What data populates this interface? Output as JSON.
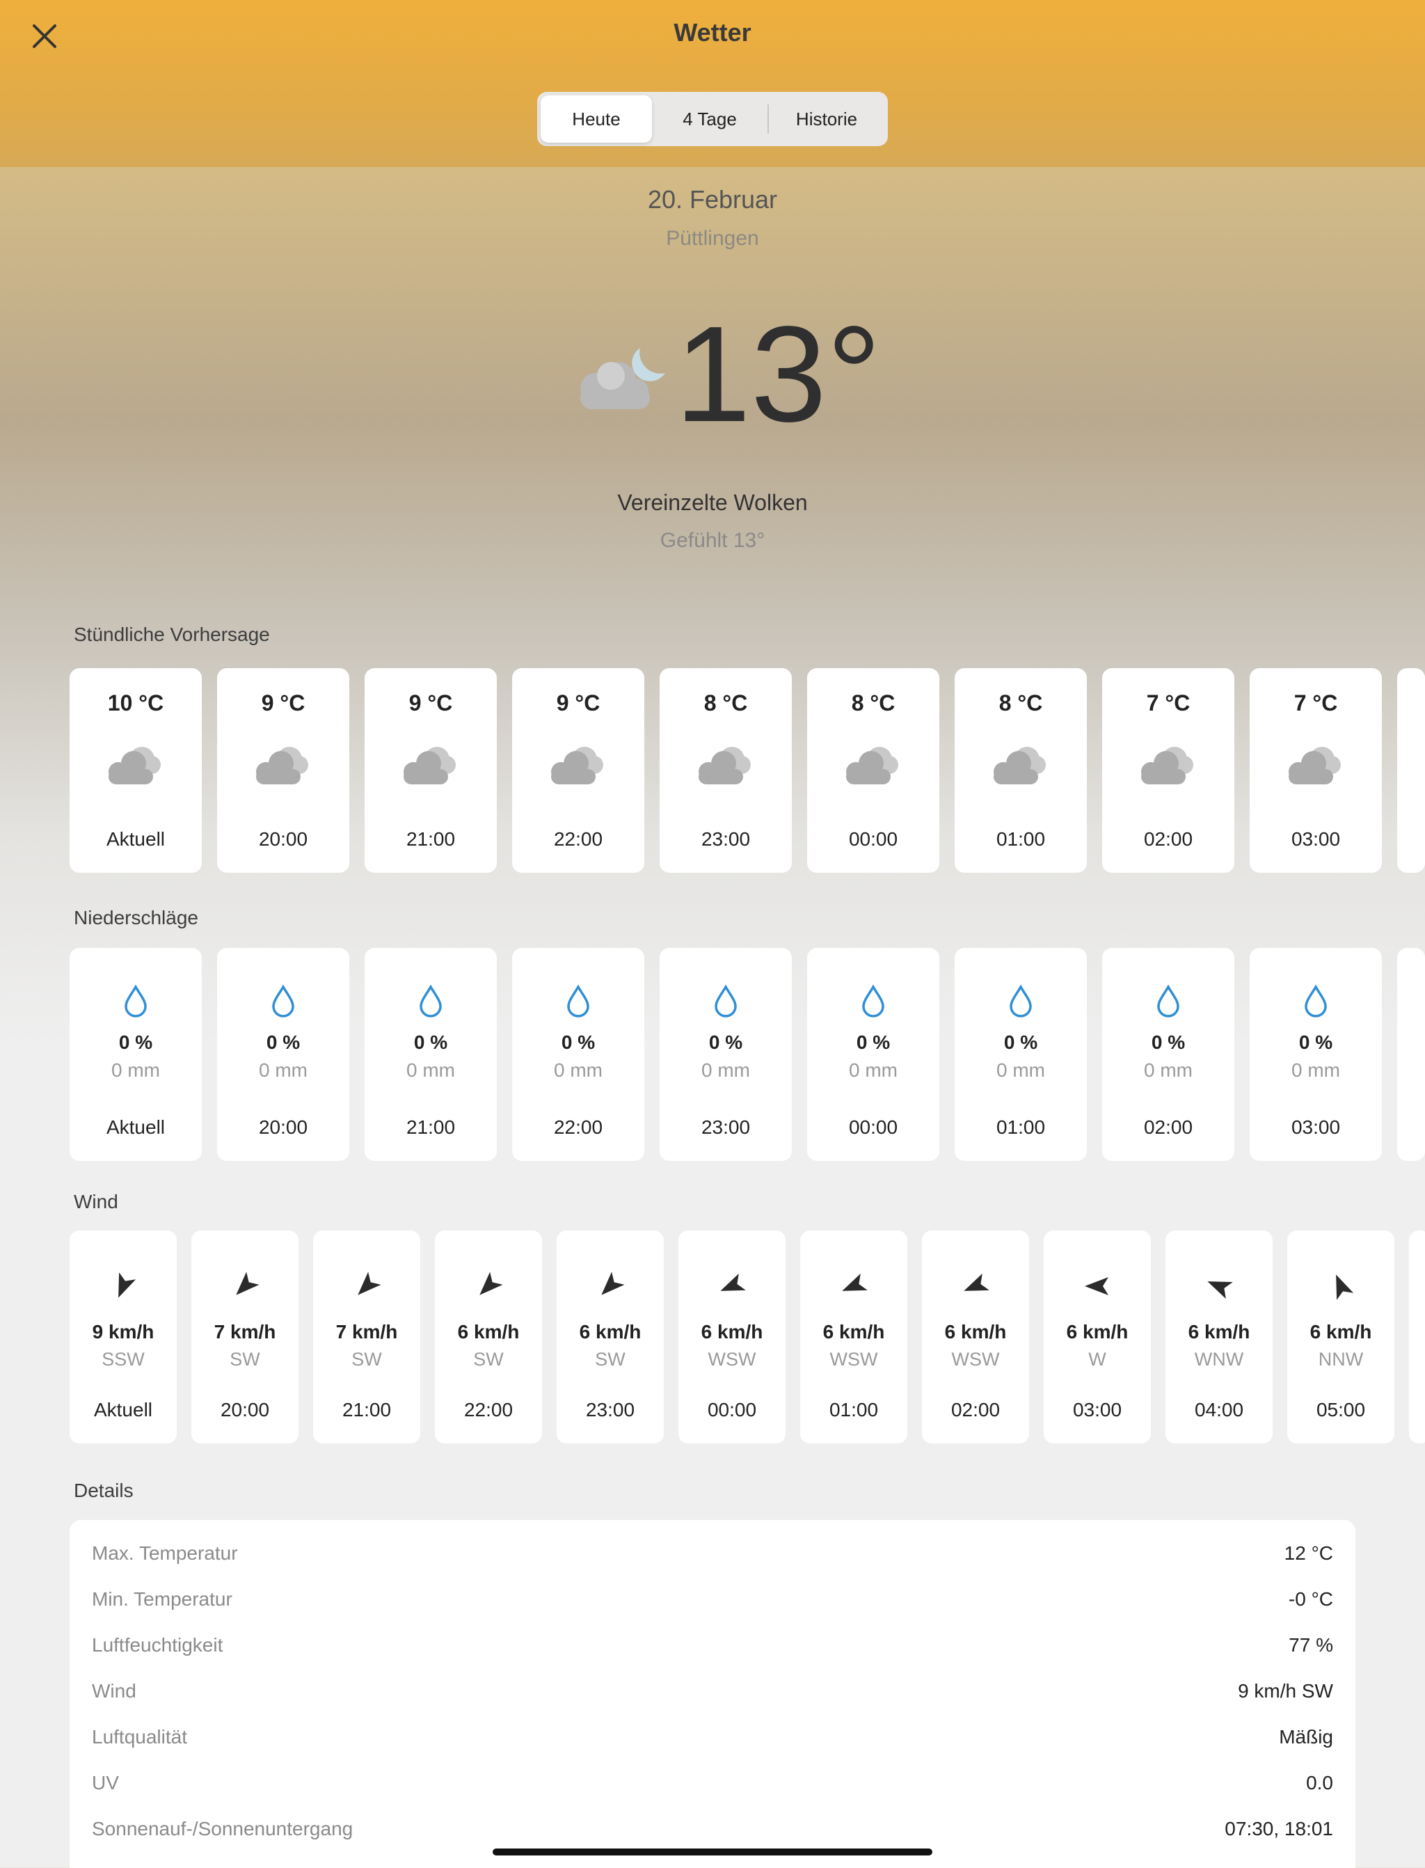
{
  "header": {
    "title": "Wetter",
    "close_icon": "close-icon"
  },
  "tabs": [
    {
      "label": "Heute",
      "active": true
    },
    {
      "label": "4 Tage"
    },
    {
      "label": "Historie"
    }
  ],
  "current": {
    "date": "20. Februar",
    "location": "Püttlingen",
    "temperature": "13°",
    "condition": "Vereinzelte Wolken",
    "feels_like": "Gefühlt 13°",
    "icon": "cloud-moon-icon"
  },
  "hourly": {
    "title": "Stündliche Vorhersage",
    "items": [
      {
        "temp": "10 °C",
        "label": "Aktuell"
      },
      {
        "temp": "9 °C",
        "label": "20:00"
      },
      {
        "temp": "9 °C",
        "label": "21:00"
      },
      {
        "temp": "9 °C",
        "label": "22:00"
      },
      {
        "temp": "8 °C",
        "label": "23:00"
      },
      {
        "temp": "8 °C",
        "label": "00:00"
      },
      {
        "temp": "8 °C",
        "label": "01:00"
      },
      {
        "temp": "7 °C",
        "label": "02:00"
      },
      {
        "temp": "7 °C",
        "label": "03:00"
      }
    ]
  },
  "precipitation": {
    "title": "Niederschläge",
    "items": [
      {
        "chance": "0 %",
        "amount": "0 mm",
        "label": "Aktuell"
      },
      {
        "chance": "0 %",
        "amount": "0 mm",
        "label": "20:00"
      },
      {
        "chance": "0 %",
        "amount": "0 mm",
        "label": "21:00"
      },
      {
        "chance": "0 %",
        "amount": "0 mm",
        "label": "22:00"
      },
      {
        "chance": "0 %",
        "amount": "0 mm",
        "label": "23:00"
      },
      {
        "chance": "0 %",
        "amount": "0 mm",
        "label": "00:00"
      },
      {
        "chance": "0 %",
        "amount": "0 mm",
        "label": "01:00"
      },
      {
        "chance": "0 %",
        "amount": "0 mm",
        "label": "02:00"
      },
      {
        "chance": "0 %",
        "amount": "0 mm",
        "label": "03:00"
      }
    ]
  },
  "wind": {
    "title": "Wind",
    "items": [
      {
        "speed": "9 km/h",
        "dir": "SSW",
        "label": "Aktuell",
        "bearing": 22.5
      },
      {
        "speed": "7 km/h",
        "dir": "SW",
        "label": "20:00",
        "bearing": 45
      },
      {
        "speed": "7 km/h",
        "dir": "SW",
        "label": "21:00",
        "bearing": 45
      },
      {
        "speed": "6 km/h",
        "dir": "SW",
        "label": "22:00",
        "bearing": 45
      },
      {
        "speed": "6 km/h",
        "dir": "SW",
        "label": "23:00",
        "bearing": 45
      },
      {
        "speed": "6 km/h",
        "dir": "WSW",
        "label": "00:00",
        "bearing": 67.5
      },
      {
        "speed": "6 km/h",
        "dir": "WSW",
        "label": "01:00",
        "bearing": 67.5
      },
      {
        "speed": "6 km/h",
        "dir": "WSW",
        "label": "02:00",
        "bearing": 67.5
      },
      {
        "speed": "6 km/h",
        "dir": "W",
        "label": "03:00",
        "bearing": 90
      },
      {
        "speed": "6 km/h",
        "dir": "WNW",
        "label": "04:00",
        "bearing": 112.5
      },
      {
        "speed": "6 km/h",
        "dir": "NNW",
        "label": "05:00",
        "bearing": 157.5
      }
    ]
  },
  "details": {
    "title": "Details",
    "rows": [
      {
        "key": "Max. Temperatur",
        "value": "12 °C"
      },
      {
        "key": "Min. Temperatur",
        "value": "-0 °C"
      },
      {
        "key": "Luftfeuchtigkeit",
        "value": "77 %"
      },
      {
        "key": "Wind",
        "value": "9 km/h SW"
      },
      {
        "key": "Luftqualität",
        "value": "Mäßig"
      },
      {
        "key": "UV",
        "value": "0.0"
      },
      {
        "key": "Sonnenauf-/Sonnenuntergang",
        "value": "07:30, 18:01"
      }
    ]
  },
  "colors": {
    "accent": "#efaf3b",
    "drop": "#2f8fd6",
    "card": "#ffffff"
  }
}
